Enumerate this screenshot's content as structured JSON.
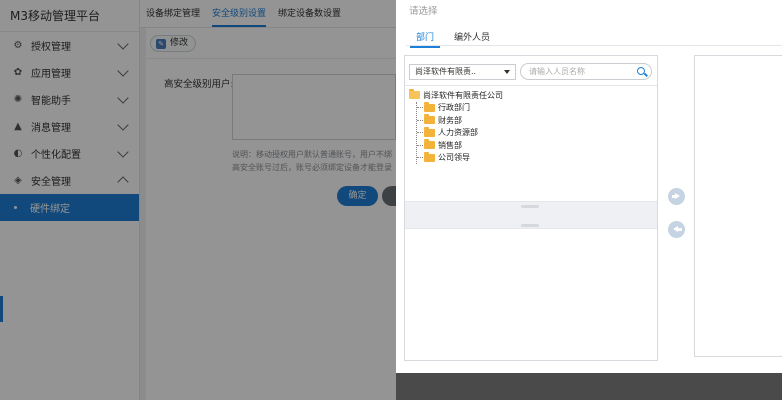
{
  "app": {
    "title": "M3移动管理平台"
  },
  "sidebar": {
    "items": [
      {
        "label": "授权管理",
        "icon": "gear-icon"
      },
      {
        "label": "应用管理",
        "icon": "apps-icon"
      },
      {
        "label": "智能助手",
        "icon": "bulb-icon"
      },
      {
        "label": "消息管理",
        "icon": "bell-icon"
      },
      {
        "label": "个性化配置",
        "icon": "palette-icon"
      },
      {
        "label": "安全管理",
        "icon": "shield-icon"
      }
    ],
    "active_subitem": "硬件绑定"
  },
  "tabs": [
    {
      "label": "设备绑定管理",
      "active": false
    },
    {
      "label": "安全级别设置",
      "active": true
    },
    {
      "label": "绑定设备数设置",
      "active": false
    }
  ],
  "content": {
    "edit_label": "修改",
    "field_label": "高安全级别用户:",
    "hint_line1": "说明：移动授权用户默认普通账号，用户不绑",
    "hint_line2": "高安全账号过后，账号必须绑定设备才能登录",
    "ok_label": "确定"
  },
  "dialog": {
    "title": "请选择",
    "tabs": [
      {
        "label": "部门",
        "active": true
      },
      {
        "label": "编外人员",
        "active": false
      }
    ],
    "dept_select_value": "尚泽软件有限责..",
    "search_placeholder": "请输入人员名称",
    "tree": {
      "root": "尚泽软件有限责任公司",
      "children": [
        "行政部门",
        "财务部",
        "人力资源部",
        "销售部",
        "公司领导"
      ]
    }
  },
  "colors": {
    "accent": "#1e7fd6",
    "folder": "#f3b23a",
    "overlay": "rgba(0,0,0,0.42)"
  }
}
